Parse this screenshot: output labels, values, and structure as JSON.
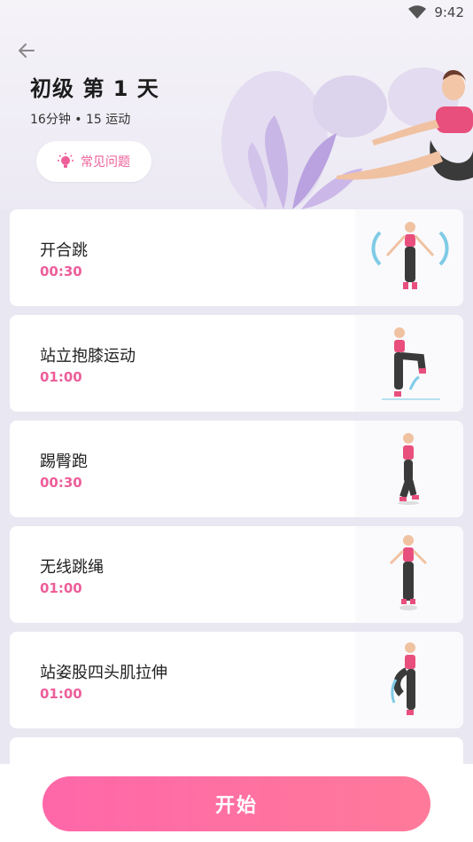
{
  "status_bar": {
    "time": "9:42"
  },
  "header": {
    "title": "初级 第 1 天",
    "subtitle": "16分钟 • 15 运动",
    "faq_label": "常见问题"
  },
  "exercises": [
    {
      "name": "开合跳",
      "duration": "00:30"
    },
    {
      "name": "站立抱膝运动",
      "duration": "01:00"
    },
    {
      "name": "踢臀跑",
      "duration": "00:30"
    },
    {
      "name": "无线跳绳",
      "duration": "01:00"
    },
    {
      "name": "站姿股四头肌拉伸",
      "duration": "01:00"
    }
  ],
  "start_button": {
    "label": "开始"
  },
  "colors": {
    "accent": "#ec5e9a",
    "button_start": "#ff67a9",
    "button_end": "#ff7a9a",
    "background": "#e9e7f1"
  }
}
